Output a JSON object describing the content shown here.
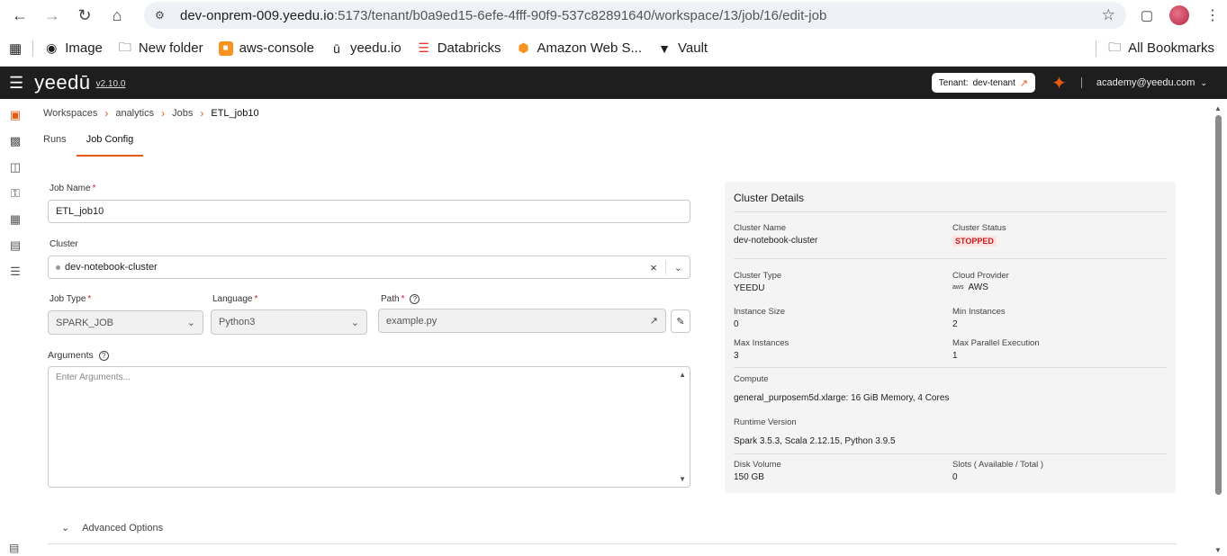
{
  "browser": {
    "url_host": "dev-onprem-009.yeedu.io",
    "url_path": ":5173/tenant/b0a9ed15-6efe-4fff-90f9-537c82891640/workspace/13/job/16/edit-job",
    "bookmarks": [
      {
        "label": "Image",
        "icon": "globe-icon"
      },
      {
        "label": "New folder",
        "icon": "folder-icon"
      },
      {
        "label": "aws-console",
        "icon": "aws-icon"
      },
      {
        "label": "yeedu.io",
        "icon": "yeedu-icon"
      },
      {
        "label": "Databricks",
        "icon": "databricks-icon"
      },
      {
        "label": "Amazon Web S...",
        "icon": "aws-cube-icon"
      },
      {
        "label": "Vault",
        "icon": "vault-icon"
      }
    ],
    "all_bookmarks": "All Bookmarks"
  },
  "app": {
    "logo": "yeedū",
    "version": "v2.10.0",
    "tenant_label": "Tenant:",
    "tenant_value": "dev-tenant",
    "user": "academy@yeedu.com"
  },
  "breadcrumb": [
    "Workspaces",
    "analytics",
    "Jobs",
    "ETL_job10"
  ],
  "tabs": [
    {
      "label": "Runs",
      "active": false
    },
    {
      "label": "Job Config",
      "active": true
    }
  ],
  "form": {
    "job_name_label": "Job Name",
    "job_name_value": "ETL_job10",
    "cluster_label": "Cluster",
    "cluster_value": "dev-notebook-cluster",
    "job_type_label": "Job Type",
    "job_type_value": "SPARK_JOB",
    "language_label": "Language",
    "language_value": "Python3",
    "path_label": "Path",
    "path_value": "example.py",
    "arguments_label": "Arguments",
    "arguments_placeholder": "Enter Arguments...",
    "advanced_label": "Advanced Options"
  },
  "cluster_details": {
    "title": "Cluster Details",
    "cluster_name_k": "Cluster Name",
    "cluster_name_v": "dev-notebook-cluster",
    "cluster_status_k": "Cluster Status",
    "cluster_status_v": "STOPPED",
    "cluster_type_k": "Cluster Type",
    "cluster_type_v": "YEEDU",
    "cloud_provider_k": "Cloud Provider",
    "cloud_provider_v": "AWS",
    "instance_size_k": "Instance Size",
    "instance_size_v": "0",
    "min_instances_k": "Min Instances",
    "min_instances_v": "2",
    "max_instances_k": "Max Instances",
    "max_instances_v": "3",
    "max_parallel_k": "Max Parallel Execution",
    "max_parallel_v": "1",
    "compute_k": "Compute",
    "compute_v": "general_purposem5d.xlarge:  16 GiB Memory,  4 Cores",
    "runtime_k": "Runtime Version",
    "runtime_v": "Spark 3.5.3, Scala 2.12.15, Python 3.9.5",
    "disk_k": "Disk Volume",
    "disk_v": "150 GB",
    "slots_k": "Slots ( Available / Total )",
    "slots_v": "0"
  },
  "colors": {
    "accent": "#e55b13",
    "header_bg": "#1e1e1e",
    "stopped_bg": "#fde2e2",
    "stopped_fg": "#c81e1e"
  }
}
